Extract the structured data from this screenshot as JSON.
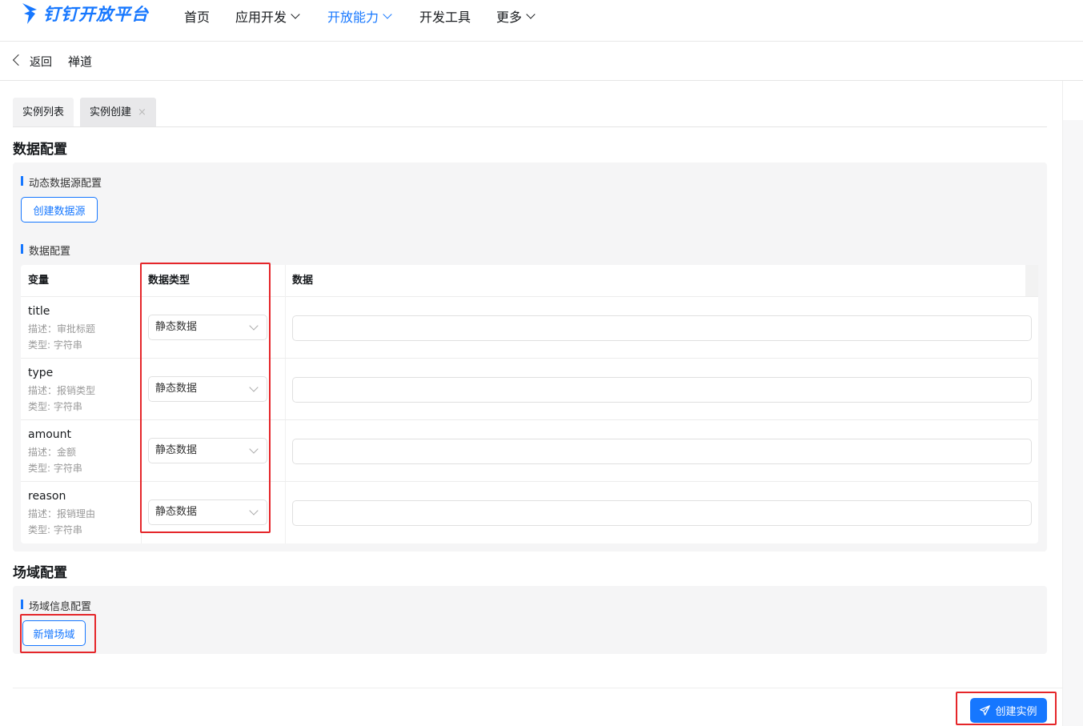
{
  "brand": {
    "name": "钉钉开放平台",
    "color": "#1677ff"
  },
  "nav": {
    "items": [
      {
        "label": "首页",
        "has_dropdown": false,
        "active": false
      },
      {
        "label": "应用开发",
        "has_dropdown": true,
        "active": false
      },
      {
        "label": "开放能力",
        "has_dropdown": true,
        "active": true
      },
      {
        "label": "开发工具",
        "has_dropdown": false,
        "active": false
      },
      {
        "label": "更多",
        "has_dropdown": true,
        "active": false
      }
    ]
  },
  "backbar": {
    "back_label": "返回",
    "title": "禅道"
  },
  "tabs": [
    {
      "label": "实例列表",
      "closable": false
    },
    {
      "label": "实例创建",
      "closable": true,
      "close_glyph": "×"
    }
  ],
  "data_config": {
    "section_title": "数据配置",
    "dynamic_source": {
      "title": "动态数据源配置",
      "button": "创建数据源"
    },
    "table": {
      "title": "数据配置",
      "headers": [
        "变量",
        "数据类型",
        "数据"
      ],
      "rows": [
        {
          "name": "title",
          "desc": "描述：审批标题",
          "type": "类型: 字符串",
          "data_type": "静态数据",
          "value": ""
        },
        {
          "name": "type",
          "desc": "描述：报销类型",
          "type": "类型: 字符串",
          "data_type": "静态数据",
          "value": ""
        },
        {
          "name": "amount",
          "desc": "描述：金额",
          "type": "类型: 字符串",
          "data_type": "静态数据",
          "value": ""
        },
        {
          "name": "reason",
          "desc": "描述：报销理由",
          "type": "类型: 字符串",
          "data_type": "静态数据",
          "value": ""
        }
      ]
    }
  },
  "scene_config": {
    "section_title": "场域配置",
    "info": {
      "title": "场域信息配置",
      "button": "新增场域"
    }
  },
  "footer": {
    "create_button": "创建实例"
  },
  "colors": {
    "accent": "#1677ff",
    "highlight": "#e5262a",
    "panel_bg": "#f5f5f6"
  }
}
